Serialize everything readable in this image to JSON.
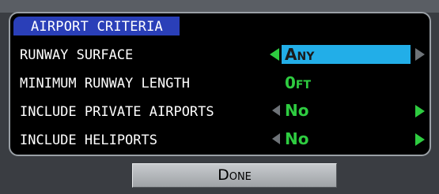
{
  "panel": {
    "title": "AIRPORT CRITERIA"
  },
  "rows": [
    {
      "label": "RUNWAY SURFACE",
      "value": "Any",
      "selected": true,
      "left_arrow_active": true,
      "right_arrow_active": false
    },
    {
      "label": "MINIMUM RUNWAY LENGTH",
      "value": "0ft",
      "selected": false
    },
    {
      "label": "INCLUDE PRIVATE AIRPORTS",
      "value": "No",
      "selected": false,
      "left_arrow_active": false,
      "right_arrow_active": true
    },
    {
      "label": "INCLUDE HELIPORTS",
      "value": "No",
      "selected": false,
      "left_arrow_active": false,
      "right_arrow_active": true
    }
  ],
  "done_button": {
    "label": "Done"
  },
  "colors": {
    "header_bg": "#2a3fb8",
    "selection_bg": "#22aee8",
    "value_green": "#2ecc40",
    "inactive_arrow": "#6e7378"
  }
}
